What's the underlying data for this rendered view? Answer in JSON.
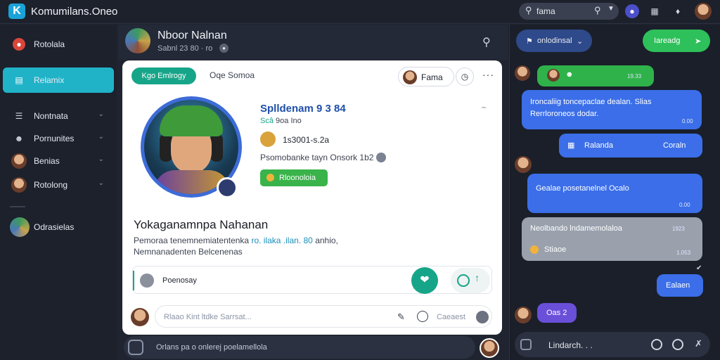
{
  "app": {
    "title": "Komumilans.Oneo",
    "logo_letter": "K"
  },
  "topbar": {
    "search_value": "fama"
  },
  "sidebar": {
    "items": [
      {
        "label": "Rotolala"
      },
      {
        "label": "Relamix"
      },
      {
        "label": "Nontnata"
      },
      {
        "label": "Pornunites"
      },
      {
        "label": "Benias"
      },
      {
        "label": "Rotolong"
      },
      {
        "label": "Odrasielas"
      }
    ]
  },
  "center": {
    "header": {
      "name": "Nboor Nalnan",
      "sub": "Sabnl 23 80 · ro"
    },
    "card": {
      "tab_active": "Kgo Emlrogy",
      "tab_other": "Oqe Somoa",
      "chip_label": "Fama",
      "profile_name": "Splldenam 9 3 84",
      "sub_prefix": "Scâ",
      "sub_text": "9oa Ino",
      "coin_text": "1s3001-s.2a",
      "meta_text": "Psomobanke tayn Onsork 1b2",
      "follow_label": "Rloonoloia",
      "bio_title": "Yokaganamnpa Nahanan",
      "bio_line1_a": "Pemoraa tenemnemiatentenka",
      "bio_line1_hl": "ro. ilaka .ilan. 80",
      "bio_line1_b": "anhio,",
      "bio_line2": "Nemnanadenten Belcenenas",
      "composer_label": "Poenosay",
      "comment_placeholder": "Rlaao Kint ltdke Sarrsat...",
      "comment_post": "Caeaest"
    },
    "bottom_placeholder": "Orlans pa o onlerej poelamellola"
  },
  "right": {
    "dropdown": "onlodinsal",
    "button": "Iareadg",
    "messages": [
      {
        "text": "",
        "time": "19.33"
      },
      {
        "text": "Ironcaliig toncepaclae dealan. Slias Rerrloroneos dodar.",
        "time": "0.00"
      },
      {
        "text": "Ralanda",
        "text2": "Coraln"
      },
      {
        "text": "Gealae posetanelnel Ocalo",
        "time": "0.00"
      },
      {
        "text": "Neolbando lndamemolaloa",
        "time": "1923",
        "sub": "Stiaoe",
        "time2": "1.053"
      },
      {
        "text": "Ealaen"
      },
      {
        "text": "Oas 2"
      }
    ],
    "input_value": "Lindarch. . ."
  },
  "colors": {
    "accent": "#20b3c8",
    "green": "#17a589",
    "blue": "#3b6ee8"
  }
}
